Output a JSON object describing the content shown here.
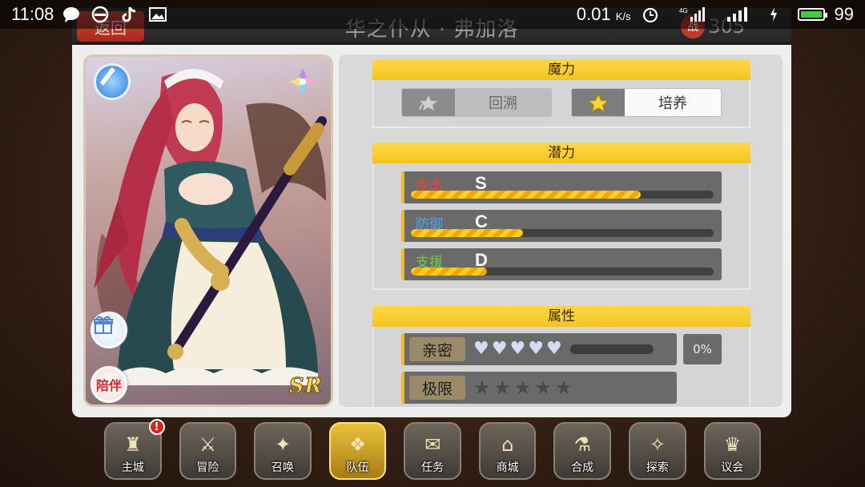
{
  "status_bar": {
    "time": "11:08",
    "net_speed": "0.01",
    "net_unit": "K/s",
    "network_type": "4G",
    "battery": "99",
    "battery_color": "#3ad13a"
  },
  "header": {
    "back_label": "返回",
    "title": "华之仆从 · 弗加洛",
    "power_badge": "战",
    "power_value": "305"
  },
  "card": {
    "rarity": "SR",
    "gift_icon": "gift-icon",
    "companion_label": "陪伴",
    "weapon_icon": "pen-weapon-icon",
    "element_icon": "flower-crystal-icon"
  },
  "magic": {
    "title": "魔力",
    "recall_label": "回溯",
    "train_label": "培养"
  },
  "potential": {
    "title": "潜力",
    "rows": [
      {
        "label": "攻击",
        "grade": "S",
        "fill": 0.76,
        "label_color": "#e8452e"
      },
      {
        "label": "防御",
        "grade": "C",
        "fill": 0.37,
        "label_color": "#4da3f0"
      },
      {
        "label": "支援",
        "grade": "D",
        "fill": 0.25,
        "label_color": "#6ad43a"
      }
    ]
  },
  "attributes": {
    "title": "属性",
    "affinity_label": "亲密",
    "affinity_hearts": 5,
    "affinity_pct": "0%",
    "limit_label": "极限",
    "limit_stars": 5
  },
  "nav": {
    "items": [
      {
        "label": "主城",
        "icon": "castle-icon",
        "alert": "!"
      },
      {
        "label": "冒险",
        "icon": "crossed-swords-icon"
      },
      {
        "label": "召唤",
        "icon": "summon-cards-icon"
      },
      {
        "label": "队伍",
        "icon": "team-crest-icon",
        "active": true
      },
      {
        "label": "任务",
        "icon": "quest-scroll-icon"
      },
      {
        "label": "商城",
        "icon": "shop-tent-icon"
      },
      {
        "label": "合成",
        "icon": "potion-icon"
      },
      {
        "label": "探索",
        "icon": "compass-icon"
      },
      {
        "label": "议会",
        "icon": "council-icon"
      }
    ]
  },
  "colors": {
    "accent_yellow": "#f2c41e",
    "back_red": "#c0392b"
  }
}
